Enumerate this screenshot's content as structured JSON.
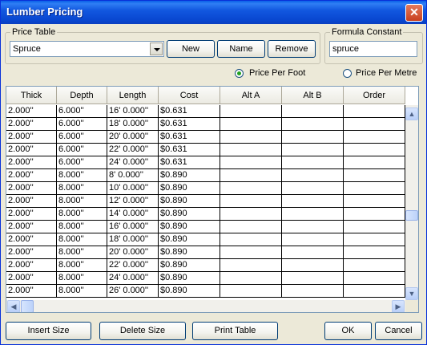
{
  "window": {
    "title": "Lumber Pricing",
    "close_glyph": "✕"
  },
  "price_table": {
    "group_label": "Price Table",
    "selected": "Spruce",
    "new_label": "New",
    "name_label": "Name",
    "remove_label": "Remove"
  },
  "formula": {
    "group_label": "Formula Constant",
    "value": "spruce"
  },
  "units": {
    "foot_label": "Price Per Foot",
    "metre_label": "Price Per Metre",
    "selected": "foot"
  },
  "table": {
    "columns": [
      "Thick",
      "Depth",
      "Length",
      "Cost",
      "Alt A",
      "Alt B",
      "Order"
    ],
    "rows": [
      [
        "2.000''",
        "6.000''",
        "16' 0.000''",
        "$0.631",
        "",
        "",
        ""
      ],
      [
        "2.000''",
        "6.000''",
        "18' 0.000''",
        "$0.631",
        "",
        "",
        ""
      ],
      [
        "2.000''",
        "6.000''",
        "20' 0.000''",
        "$0.631",
        "",
        "",
        ""
      ],
      [
        "2.000''",
        "6.000''",
        "22' 0.000''",
        "$0.631",
        "",
        "",
        ""
      ],
      [
        "2.000''",
        "6.000''",
        "24' 0.000''",
        "$0.631",
        "",
        "",
        ""
      ],
      [
        "2.000''",
        "8.000''",
        "8' 0.000''",
        "$0.890",
        "",
        "",
        ""
      ],
      [
        "2.000''",
        "8.000''",
        "10' 0.000''",
        "$0.890",
        "",
        "",
        ""
      ],
      [
        "2.000''",
        "8.000''",
        "12' 0.000''",
        "$0.890",
        "",
        "",
        ""
      ],
      [
        "2.000''",
        "8.000''",
        "14' 0.000''",
        "$0.890",
        "",
        "",
        ""
      ],
      [
        "2.000''",
        "8.000''",
        "16' 0.000''",
        "$0.890",
        "",
        "",
        ""
      ],
      [
        "2.000''",
        "8.000''",
        "18' 0.000''",
        "$0.890",
        "",
        "",
        ""
      ],
      [
        "2.000''",
        "8.000''",
        "20' 0.000''",
        "$0.890",
        "",
        "",
        ""
      ],
      [
        "2.000''",
        "8.000''",
        "22' 0.000''",
        "$0.890",
        "",
        "",
        ""
      ],
      [
        "2.000''",
        "8.000''",
        "24' 0.000''",
        "$0.890",
        "",
        "",
        ""
      ],
      [
        "2.000''",
        "8.000''",
        "26' 0.000''",
        "$0.890",
        "",
        "",
        ""
      ]
    ]
  },
  "buttons": {
    "insert_size": "Insert Size",
    "delete_size": "Delete Size",
    "print_table": "Print Table",
    "ok": "OK",
    "cancel": "Cancel"
  },
  "scroll_glyphs": {
    "up": "▲",
    "down": "▼",
    "left": "◀",
    "right": "▶"
  }
}
